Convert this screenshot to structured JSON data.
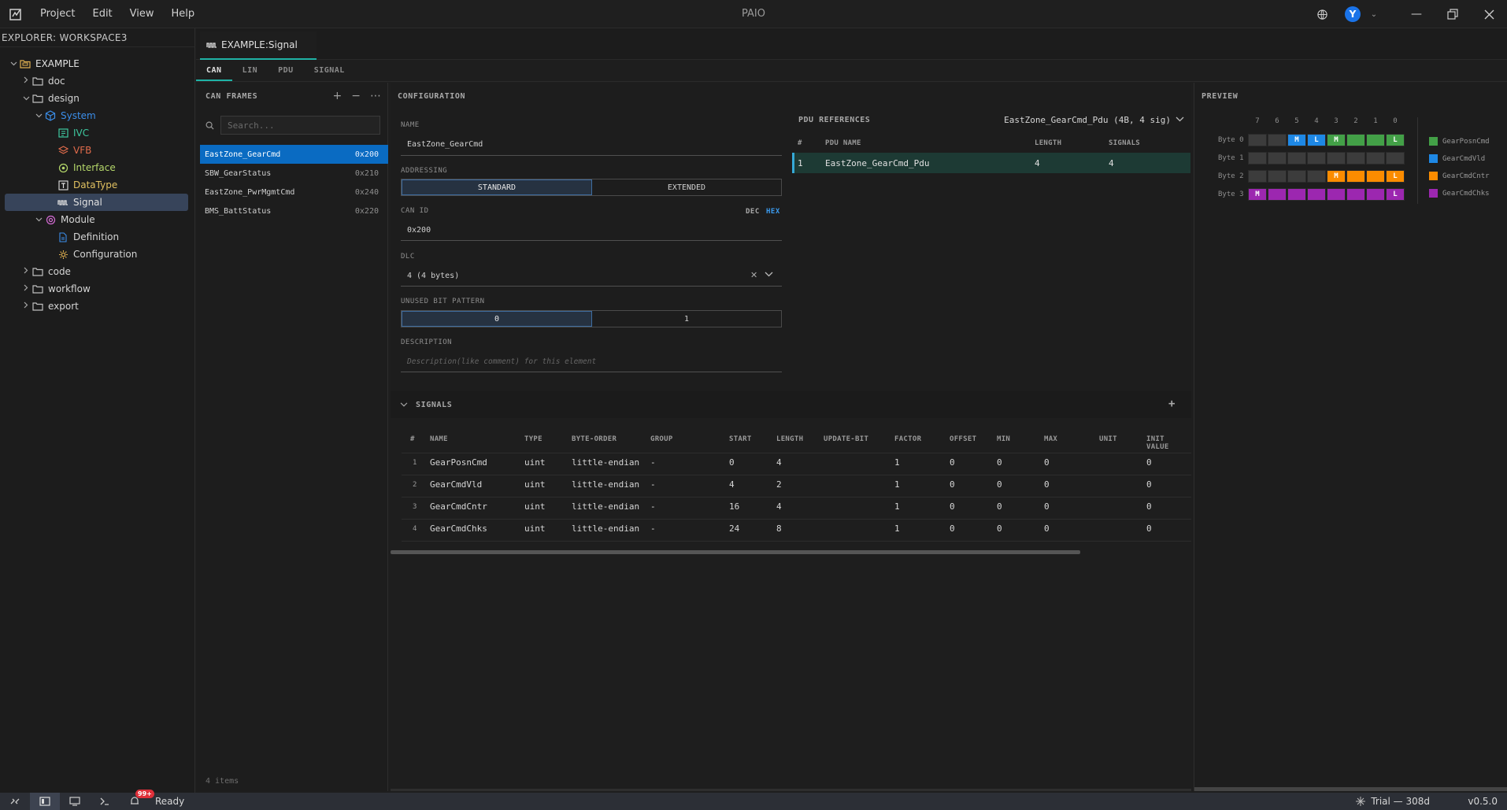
{
  "app": {
    "title": "PAIO",
    "menu": [
      "Project",
      "Edit",
      "View",
      "Help"
    ],
    "avatar_initial": "Y"
  },
  "explorer": {
    "header": "EXPLORER: WORKSPACE3",
    "tree": [
      {
        "label": "EXAMPLE",
        "depth": 0,
        "chevron": "down",
        "icon": "root-folder-icon",
        "color": "#e0e0e0"
      },
      {
        "label": "doc",
        "depth": 1,
        "chevron": "right",
        "icon": "folder-icon",
        "color": "#d4d4d4"
      },
      {
        "label": "design",
        "depth": 1,
        "chevron": "down",
        "icon": "folder-icon",
        "color": "#d4d4d4"
      },
      {
        "label": "System",
        "depth": 2,
        "chevron": "down",
        "icon": "cube-icon",
        "color": "#3b8eea"
      },
      {
        "label": "IVC",
        "depth": 3,
        "chevron": "",
        "icon": "grid-icon",
        "color": "#3ec9a0"
      },
      {
        "label": "VFB",
        "depth": 3,
        "chevron": "",
        "icon": "layers-icon",
        "color": "#e06b4b"
      },
      {
        "label": "Interface",
        "depth": 3,
        "chevron": "",
        "icon": "interface-icon",
        "color": "#b5d86a"
      },
      {
        "label": "DataType",
        "depth": 3,
        "chevron": "",
        "icon": "datatype-icon",
        "color": "#e0c060"
      },
      {
        "label": "Signal",
        "depth": 3,
        "chevron": "",
        "icon": "signal-icon",
        "color": "#e0e0e0",
        "selected": true
      },
      {
        "label": "Module",
        "depth": 2,
        "chevron": "down",
        "icon": "module-icon",
        "color": "#d4d4d4"
      },
      {
        "label": "Definition",
        "depth": 3,
        "chevron": "",
        "icon": "file-icon",
        "color": "#d4d4d4"
      },
      {
        "label": "Configuration",
        "depth": 3,
        "chevron": "",
        "icon": "gear-icon",
        "color": "#d4d4d4"
      },
      {
        "label": "code",
        "depth": 1,
        "chevron": "right",
        "icon": "folder-icon",
        "color": "#d4d4d4"
      },
      {
        "label": "workflow",
        "depth": 1,
        "chevron": "right",
        "icon": "folder-icon",
        "color": "#d4d4d4"
      },
      {
        "label": "export",
        "depth": 1,
        "chevron": "right",
        "icon": "folder-icon",
        "color": "#d4d4d4"
      }
    ]
  },
  "editor": {
    "tab_label": "EXAMPLE:Signal",
    "protocol_tabs": [
      "CAN",
      "LIN",
      "PDU",
      "SIGNAL"
    ],
    "active_protocol": "CAN"
  },
  "frames": {
    "header": "CAN FRAMES",
    "search_placeholder": "Search...",
    "items": [
      {
        "name": "EastZone_GearCmd",
        "id": "0x200",
        "selected": true
      },
      {
        "name": "SBW_GearStatus",
        "id": "0x210"
      },
      {
        "name": "EastZone_PwrMgmtCmd",
        "id": "0x240"
      },
      {
        "name": "BMS_BattStatus",
        "id": "0x220"
      }
    ],
    "footer": "4 items"
  },
  "config": {
    "header": "CONFIGURATION",
    "name_label": "NAME",
    "name_value": "EastZone_GearCmd",
    "addressing_label": "ADDRESSING",
    "addressing_options": [
      "STANDARD",
      "EXTENDED"
    ],
    "addressing_selected": "STANDARD",
    "canid_label": "CAN ID",
    "canid_value": "0x200",
    "format_dec": "DEC",
    "format_hex": "HEX",
    "dlc_label": "DLC",
    "dlc_value": "4 (4 bytes)",
    "unused_label": "UNUSED BIT PATTERN",
    "unused_options": [
      "0",
      "1"
    ],
    "unused_selected": "0",
    "desc_label": "DESCRIPTION",
    "desc_placeholder": "Description(like comment) for this element"
  },
  "pdu": {
    "header": "PDU REFERENCES",
    "selected": "EastZone_GearCmd_Pdu (4B, 4 sig)",
    "columns": [
      "#",
      "PDU NAME",
      "LENGTH",
      "SIGNALS"
    ],
    "rows": [
      {
        "idx": "1",
        "name": "EastZone_GearCmd_Pdu",
        "length": "4",
        "signals": "4"
      }
    ]
  },
  "preview": {
    "header": "PREVIEW",
    "bit_headers": [
      "7",
      "6",
      "5",
      "4",
      "3",
      "2",
      "1",
      "0"
    ],
    "bytes": [
      {
        "label": "Byte 0",
        "cells": [
          {
            "c": ""
          },
          {
            "c": ""
          },
          {
            "c": "#1e88e5",
            "t": "M"
          },
          {
            "c": "#1e88e5",
            "t": "L"
          },
          {
            "c": "#43a047",
            "t": "M"
          },
          {
            "c": "#43a047"
          },
          {
            "c": "#43a047"
          },
          {
            "c": "#43a047",
            "t": "L"
          }
        ]
      },
      {
        "label": "Byte 1",
        "cells": [
          {
            "c": ""
          },
          {
            "c": ""
          },
          {
            "c": ""
          },
          {
            "c": ""
          },
          {
            "c": ""
          },
          {
            "c": ""
          },
          {
            "c": ""
          },
          {
            "c": ""
          }
        ]
      },
      {
        "label": "Byte 2",
        "cells": [
          {
            "c": ""
          },
          {
            "c": ""
          },
          {
            "c": ""
          },
          {
            "c": ""
          },
          {
            "c": "#fb8c00",
            "t": "M"
          },
          {
            "c": "#fb8c00"
          },
          {
            "c": "#fb8c00"
          },
          {
            "c": "#fb8c00",
            "t": "L"
          }
        ]
      },
      {
        "label": "Byte 3",
        "cells": [
          {
            "c": "#9c27b0",
            "t": "M"
          },
          {
            "c": "#9c27b0"
          },
          {
            "c": "#9c27b0"
          },
          {
            "c": "#9c27b0"
          },
          {
            "c": "#9c27b0"
          },
          {
            "c": "#9c27b0"
          },
          {
            "c": "#9c27b0"
          },
          {
            "c": "#9c27b0",
            "t": "L"
          }
        ]
      }
    ],
    "legend": [
      {
        "name": "GearPosnCmd",
        "color": "#43a047"
      },
      {
        "name": "GearCmdVld",
        "color": "#1e88e5"
      },
      {
        "name": "GearCmdCntr",
        "color": "#fb8c00"
      },
      {
        "name": "GearCmdChks",
        "color": "#9c27b0"
      }
    ]
  },
  "signals": {
    "header": "SIGNALS",
    "columns": [
      "#",
      "NAME",
      "TYPE",
      "BYTE-ORDER",
      "GROUP",
      "START",
      "LENGTH",
      "UPDATE-BIT",
      "FACTOR",
      "OFFSET",
      "MIN",
      "MAX",
      "UNIT",
      "INIT VALUE"
    ],
    "rows": [
      {
        "idx": "1",
        "name": "GearPosnCmd",
        "type": "uint",
        "order": "little-endian",
        "group": "-",
        "start": "0",
        "length": "4",
        "update": "",
        "factor": "1",
        "offset": "0",
        "min": "0",
        "max": "0",
        "unit": "",
        "init": "0"
      },
      {
        "idx": "2",
        "name": "GearCmdVld",
        "type": "uint",
        "order": "little-endian",
        "group": "-",
        "start": "4",
        "length": "2",
        "update": "",
        "factor": "1",
        "offset": "0",
        "min": "0",
        "max": "0",
        "unit": "",
        "init": "0"
      },
      {
        "idx": "3",
        "name": "GearCmdCntr",
        "type": "uint",
        "order": "little-endian",
        "group": "-",
        "start": "16",
        "length": "4",
        "update": "",
        "factor": "1",
        "offset": "0",
        "min": "0",
        "max": "0",
        "unit": "",
        "init": "0"
      },
      {
        "idx": "4",
        "name": "GearCmdChks",
        "type": "uint",
        "order": "little-endian",
        "group": "-",
        "start": "24",
        "length": "8",
        "update": "",
        "factor": "1",
        "offset": "0",
        "min": "0",
        "max": "0",
        "unit": "",
        "init": "0"
      }
    ]
  },
  "status": {
    "badge": "99+",
    "text": "Ready",
    "trial": "Trial — 308d",
    "version": "v0.5.0"
  }
}
